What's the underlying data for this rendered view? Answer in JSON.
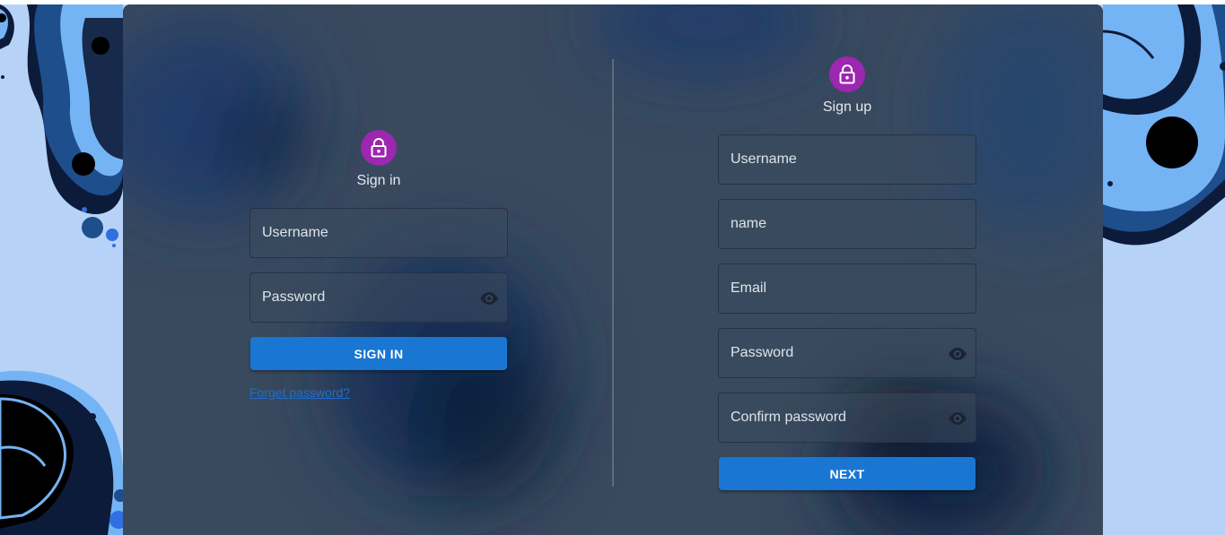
{
  "signin": {
    "title": "Sign in",
    "username_label": "Username",
    "password_label": "Password",
    "submit_label": "SIGN IN",
    "forget_link": "Forget password?"
  },
  "signup": {
    "title": "Sign up",
    "username_label": "Username",
    "name_label": "name",
    "email_label": "Email",
    "password_label": "Password",
    "confirm_label": "Confirm password",
    "submit_label": "NEXT"
  },
  "icons": {
    "lock": "lock-outline-icon",
    "visibility": "eye-icon"
  },
  "colors": {
    "accent": "#1976d2",
    "avatar": "#9c27b0",
    "card": "#3a4a5e",
    "page_background": "#b7d2f7",
    "link": "#1e6fcf"
  }
}
